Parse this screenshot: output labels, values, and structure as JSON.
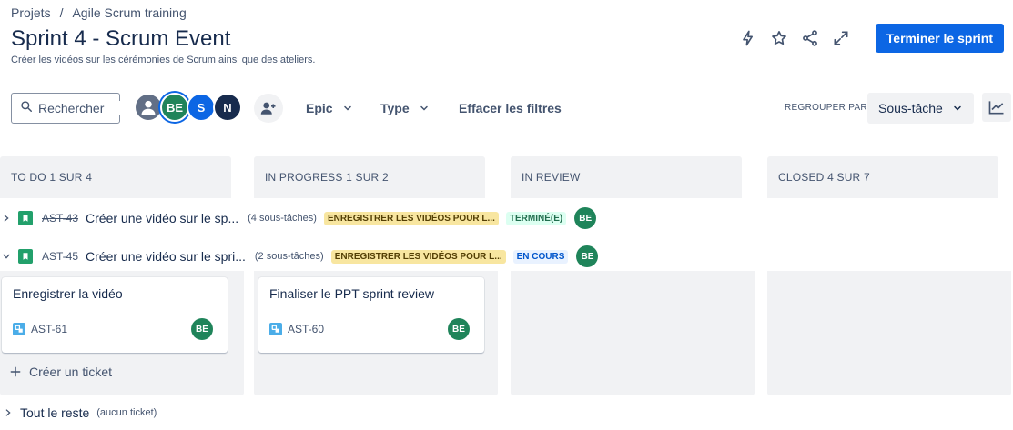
{
  "breadcrumb": {
    "items": [
      "Projets",
      "Agile Scrum training"
    ],
    "separator": "/"
  },
  "header": {
    "title": "Sprint 4 - Scrum Event",
    "description": "Créer les vidéos sur les cérémonies de Scrum ainsi que des ateliers.",
    "action_icons": [
      "lightning-icon",
      "star-icon",
      "share-icon",
      "expand-icon"
    ],
    "complete_sprint_label": "Terminer le sprint"
  },
  "toolbar": {
    "search_placeholder": "Rechercher",
    "avatars": [
      "",
      "BE",
      "S",
      "N"
    ],
    "epic_label": "Epic",
    "type_label": "Type",
    "clear_filters_label": "Effacer les filtres",
    "group_by_label": "REGROUPER PAR",
    "group_by_value": "Sous-tâche"
  },
  "columns": [
    {
      "label": "TO DO 1 SUR 4"
    },
    {
      "label": "IN PROGRESS 1 SUR 2"
    },
    {
      "label": "IN REVIEW"
    },
    {
      "label": "CLOSED 4 SUR 7"
    }
  ],
  "swimlanes": [
    {
      "key": "AST-43",
      "summary": "Créer une vidéo sur le sp...",
      "subtasks": "(4 sous-tâches)",
      "epic": "ENREGISTRER LES VIDÉOS POUR L...",
      "status": "TERMINÉ(E)",
      "assignee": "BE",
      "expanded": false
    },
    {
      "key": "AST-45",
      "summary": "Créer une vidéo sur le spri...",
      "subtasks": "(2 sous-tâches)",
      "epic": "ENREGISTRER LES VIDÉOS POUR L...",
      "status": "EN COURS",
      "assignee": "BE",
      "expanded": true
    }
  ],
  "cards": [
    {
      "title": "Enregistrer la vidéo",
      "key": "AST-61",
      "assignee": "BE",
      "column": "TO DO"
    },
    {
      "title": "Finaliser le PPT sprint review",
      "key": "AST-60",
      "assignee": "BE",
      "column": "IN PROGRESS"
    }
  ],
  "create_ticket_label": "Créer un ticket",
  "rest_lane": {
    "label": "Tout le reste",
    "count": "(aucun ticket)"
  },
  "colors": {
    "primary": "#0c66e4",
    "column_bg": "#f1f2f4",
    "story": "#22a06b",
    "avatar_green": "#1f845a"
  }
}
